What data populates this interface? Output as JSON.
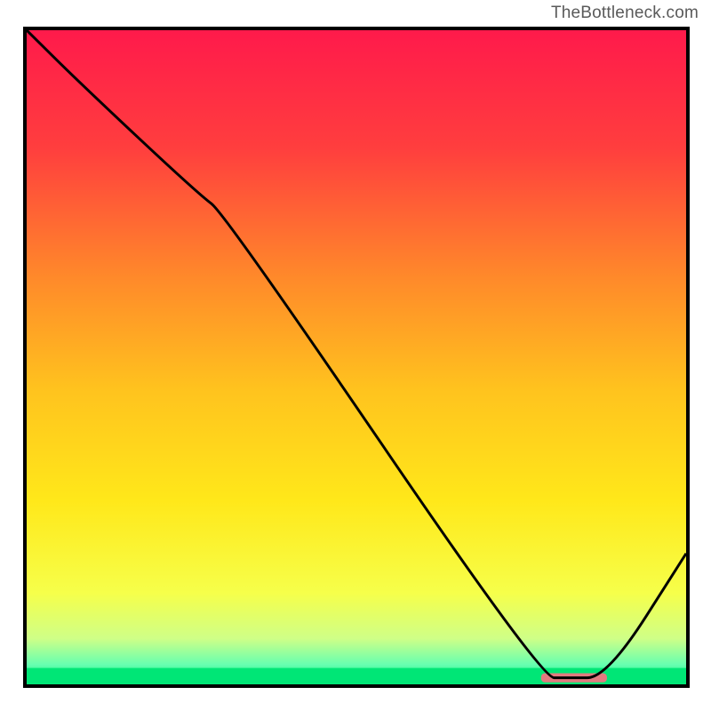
{
  "attribution": "TheBottleneck.com",
  "chart_data": {
    "type": "line",
    "title": "",
    "xlabel": "",
    "ylabel": "",
    "xlim": [
      0,
      100
    ],
    "ylim": [
      0,
      100
    ],
    "grid": false,
    "legend": false,
    "gradient_stops": [
      {
        "pos": 0.0,
        "color": "#ff1a4b"
      },
      {
        "pos": 0.18,
        "color": "#ff3e3e"
      },
      {
        "pos": 0.38,
        "color": "#ff8a2a"
      },
      {
        "pos": 0.55,
        "color": "#ffc31e"
      },
      {
        "pos": 0.72,
        "color": "#ffe81a"
      },
      {
        "pos": 0.86,
        "color": "#f6ff4a"
      },
      {
        "pos": 0.93,
        "color": "#cfff87"
      },
      {
        "pos": 0.97,
        "color": "#66ffb0"
      },
      {
        "pos": 1.0,
        "color": "#00e676"
      }
    ],
    "green_band_top_fraction": 0.975,
    "optimum_marker": {
      "x_start": 78,
      "x_end": 88,
      "y": 1,
      "color": "#e27a7f"
    },
    "series": [
      {
        "name": "bottleneck-curve",
        "color": "#000000",
        "x": [
          0,
          8,
          26,
          30,
          78,
          82,
          88,
          100
        ],
        "y": [
          100,
          92,
          75,
          72,
          1,
          1,
          1,
          20
        ]
      }
    ],
    "annotations": []
  }
}
